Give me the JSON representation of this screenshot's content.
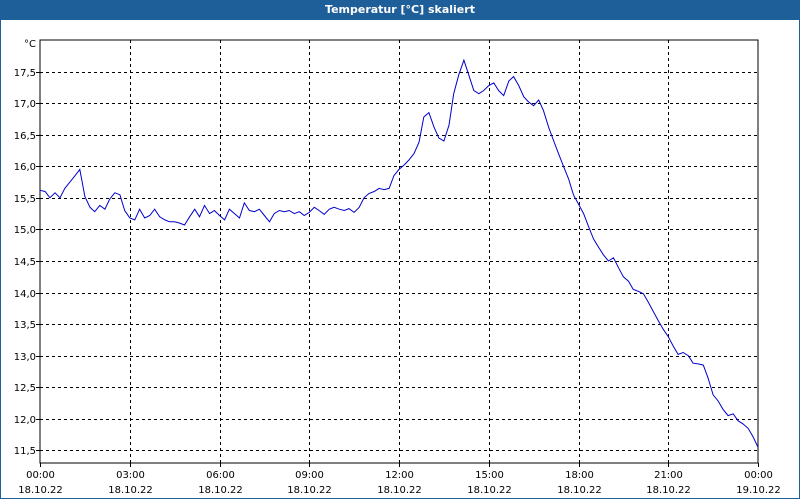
{
  "window": {
    "title": "Temperatur [°C] skaliert"
  },
  "chart_data": {
    "type": "line",
    "title": "Temperatur [°C] skaliert",
    "ylabel": "°C",
    "xlabel": "",
    "ylim": [
      11.3,
      18.0
    ],
    "xlim": [
      0,
      24
    ],
    "grid": true,
    "y_ticks": [
      "11,5",
      "12,0",
      "12,5",
      "13,0",
      "13,5",
      "14,0",
      "14,5",
      "15,0",
      "15,5",
      "16,0",
      "16,5",
      "17,0",
      "17,5"
    ],
    "x_ticks": [
      {
        "time": "00:00",
        "date": "18.10.22"
      },
      {
        "time": "03:00",
        "date": "18.10.22"
      },
      {
        "time": "06:00",
        "date": "18.10.22"
      },
      {
        "time": "09:00",
        "date": "18.10.22"
      },
      {
        "time": "12:00",
        "date": "18.10.22"
      },
      {
        "time": "15:00",
        "date": "18.10.22"
      },
      {
        "time": "18:00",
        "date": "18.10.22"
      },
      {
        "time": "21:00",
        "date": "18.10.22"
      },
      {
        "time": "00:00",
        "date": "19.10.22"
      }
    ],
    "line_color": "#0000cc",
    "series": [
      {
        "x": [
          0.0,
          0.17,
          0.33,
          0.5,
          0.67,
          0.83,
          1.0,
          1.17,
          1.33,
          1.5,
          1.67,
          1.83,
          2.0,
          2.17,
          2.33,
          2.5,
          2.67,
          2.83,
          3.0,
          3.17,
          3.33,
          3.5,
          3.67,
          3.83,
          4.0,
          4.17,
          4.33,
          4.5,
          4.67,
          4.83,
          5.0,
          5.17,
          5.33,
          5.5,
          5.67,
          5.83,
          6.0,
          6.17,
          6.33,
          6.5,
          6.67,
          6.83,
          7.0,
          7.17,
          7.33,
          7.5,
          7.67,
          7.83,
          8.0,
          8.17,
          8.33,
          8.5,
          8.67,
          8.83,
          9.0,
          9.17,
          9.33,
          9.5,
          9.67,
          9.83,
          10.0,
          10.17,
          10.33,
          10.5,
          10.67,
          10.83,
          11.0,
          11.17,
          11.33,
          11.5,
          11.67,
          11.83,
          12.0,
          12.17,
          12.33,
          12.5,
          12.67,
          12.83,
          13.0,
          13.17,
          13.33,
          13.5,
          13.67,
          13.83,
          14.0,
          14.17,
          14.33,
          14.5,
          14.67,
          14.83,
          15.0,
          15.17,
          15.33,
          15.5,
          15.67,
          15.83,
          16.0,
          16.17,
          16.33,
          16.5,
          16.67,
          16.83,
          17.0,
          17.17,
          17.33,
          17.5,
          17.67,
          17.83,
          18.0,
          18.17,
          18.33,
          18.5,
          18.67,
          18.83,
          19.0,
          19.17,
          19.33,
          19.5,
          19.67,
          19.83,
          20.0,
          20.17,
          20.33,
          20.5,
          20.67,
          20.83,
          21.0,
          21.17,
          21.33,
          21.5,
          21.67,
          21.83,
          22.0,
          22.17,
          22.33,
          22.5,
          22.67,
          22.83,
          23.0,
          23.17,
          23.33,
          23.5,
          23.67,
          23.83,
          24.0
        ],
        "y": [
          15.62,
          15.6,
          15.5,
          15.58,
          15.5,
          15.65,
          15.75,
          15.85,
          15.95,
          15.52,
          15.35,
          15.28,
          15.38,
          15.32,
          15.48,
          15.58,
          15.55,
          15.3,
          15.18,
          15.15,
          15.32,
          15.18,
          15.22,
          15.32,
          15.2,
          15.15,
          15.12,
          15.12,
          15.1,
          15.07,
          15.2,
          15.32,
          15.2,
          15.38,
          15.25,
          15.3,
          15.22,
          15.15,
          15.32,
          15.25,
          15.18,
          15.42,
          15.3,
          15.28,
          15.32,
          15.22,
          15.12,
          15.25,
          15.3,
          15.28,
          15.3,
          15.25,
          15.28,
          15.22,
          15.27,
          15.35,
          15.3,
          15.24,
          15.32,
          15.35,
          15.32,
          15.3,
          15.33,
          15.27,
          15.35,
          15.5,
          15.57,
          15.6,
          15.65,
          15.63,
          15.65,
          15.85,
          15.95,
          16.02,
          16.1,
          16.2,
          16.38,
          16.78,
          16.85,
          16.62,
          16.45,
          16.4,
          16.65,
          17.15,
          17.45,
          17.68,
          17.45,
          17.2,
          17.15,
          17.2,
          17.28,
          17.32,
          17.2,
          17.12,
          17.35,
          17.42,
          17.28,
          17.1,
          17.02,
          16.96,
          17.05,
          16.88,
          16.62,
          16.4,
          16.2,
          16.0,
          15.8,
          15.55,
          15.4,
          15.25,
          15.05,
          14.85,
          14.72,
          14.6,
          14.5,
          14.55,
          14.4,
          14.25,
          14.18,
          14.05,
          14.02,
          13.98,
          13.85,
          13.7,
          13.55,
          13.42,
          13.3,
          13.15,
          13.02,
          13.05,
          13.0,
          12.88,
          12.87,
          12.85,
          12.65,
          12.38,
          12.28,
          12.15,
          12.05,
          12.08,
          11.97,
          11.92,
          11.85,
          11.72,
          11.55
        ]
      }
    ]
  }
}
